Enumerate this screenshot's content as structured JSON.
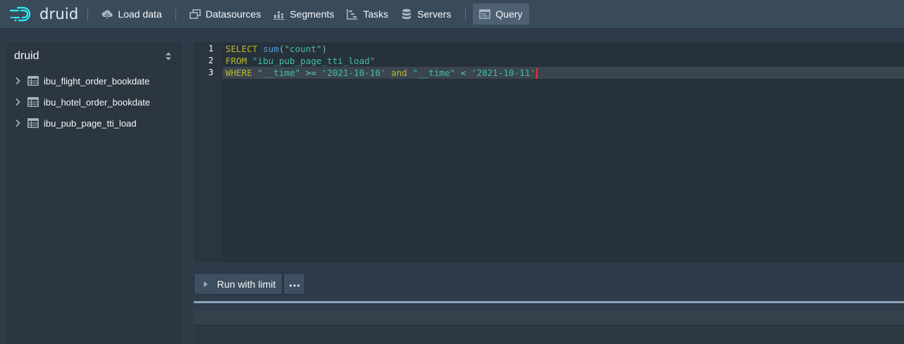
{
  "brand": {
    "name": "druid",
    "logo_icon": "druid-logo-icon"
  },
  "nav": {
    "items": [
      {
        "label": "Load data",
        "icon": "cloud-upload-icon",
        "active": false
      },
      {
        "label": "Datasources",
        "icon": "multi-select-icon",
        "active": false
      },
      {
        "label": "Segments",
        "icon": "stacked-chart-icon",
        "active": false
      },
      {
        "label": "Tasks",
        "icon": "gantt-chart-icon",
        "active": false
      },
      {
        "label": "Servers",
        "icon": "database-icon",
        "active": false
      },
      {
        "label": "Query",
        "icon": "application-icon",
        "active": true
      }
    ]
  },
  "sidebar": {
    "title": "druid",
    "items": [
      {
        "label": "ibu_flight_order_bookdate"
      },
      {
        "label": "ibu_hotel_order_bookdate"
      },
      {
        "label": "ibu_pub_page_tti_load"
      }
    ]
  },
  "editor": {
    "line_numbers": [
      "1",
      "2",
      "3"
    ],
    "lines": [
      [
        {
          "t": "SELECT",
          "c": "kw"
        },
        {
          "t": " ",
          "c": ""
        },
        {
          "t": "sum",
          "c": "fn"
        },
        {
          "t": "(",
          "c": "op"
        },
        {
          "t": "\"count\"",
          "c": "str"
        },
        {
          "t": ")",
          "c": "op"
        }
      ],
      [
        {
          "t": "FROM",
          "c": "kw"
        },
        {
          "t": " ",
          "c": ""
        },
        {
          "t": "\"ibu_pub_page_tti_load\"",
          "c": "str"
        }
      ],
      [
        {
          "t": "WHERE",
          "c": "kw"
        },
        {
          "t": " ",
          "c": ""
        },
        {
          "t": "\"__time\"",
          "c": "str"
        },
        {
          "t": " ",
          "c": ""
        },
        {
          "t": ">=",
          "c": "op"
        },
        {
          "t": " ",
          "c": ""
        },
        {
          "t": "'2021-10-10'",
          "c": "str"
        },
        {
          "t": " ",
          "c": ""
        },
        {
          "t": "and",
          "c": "kw"
        },
        {
          "t": " ",
          "c": ""
        },
        {
          "t": "\"__time\"",
          "c": "str"
        },
        {
          "t": " ",
          "c": ""
        },
        {
          "t": "<",
          "c": "op"
        },
        {
          "t": " ",
          "c": ""
        },
        {
          "t": "'2021-10-11'",
          "c": "str"
        }
      ]
    ],
    "active_line": 3
  },
  "run": {
    "label": "Run with limit",
    "play_icon": "play-icon",
    "more_icon": "more-icon"
  }
}
